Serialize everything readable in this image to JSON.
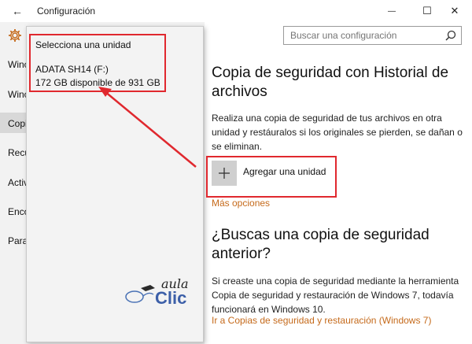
{
  "titlebar": {
    "title": "Configuración",
    "back_glyph": "←",
    "minimize_glyph": "—",
    "maximize_glyph": "☐",
    "close_glyph": "✕"
  },
  "sidebar": {
    "items": [
      {
        "label": "Winc"
      },
      {
        "label": "Winc"
      },
      {
        "label": "Copia"
      },
      {
        "label": "Recup"
      },
      {
        "label": "Activ"
      },
      {
        "label": "Enco"
      },
      {
        "label": "Para"
      }
    ],
    "selected_index": 2
  },
  "popup": {
    "heading": "Selecciona una unidad",
    "drive_name": "ADATA SH14 (F:)",
    "drive_space": "172 GB disponible de 931 GB"
  },
  "search": {
    "placeholder": "Buscar una configuración"
  },
  "main": {
    "title": "Copia de seguridad con Historial de archivos",
    "description": "Realiza una copia de seguridad de tus archivos en otra unidad y restáuralos si los originales se pierden, se dañan o se eliminan.",
    "add_drive_label": "Agregar una unidad",
    "more_options": "Más opciones",
    "old_backup_title": "¿Buscas una copia de seguridad anterior?",
    "old_backup_text": "Si creaste una copia de seguridad mediante la herramienta Copia de seguridad y restauración de Windows 7, todavía funcionará en Windows 10.",
    "old_backup_link": "Ir a Copias de seguridad y restauración (Windows 7)"
  },
  "watermark": {
    "line1": "aula",
    "line2": "Clic"
  },
  "colors": {
    "accent": "#c56a1b",
    "annotation_red": "#e0282e",
    "sidebar_bg": "#f2f2f2"
  }
}
